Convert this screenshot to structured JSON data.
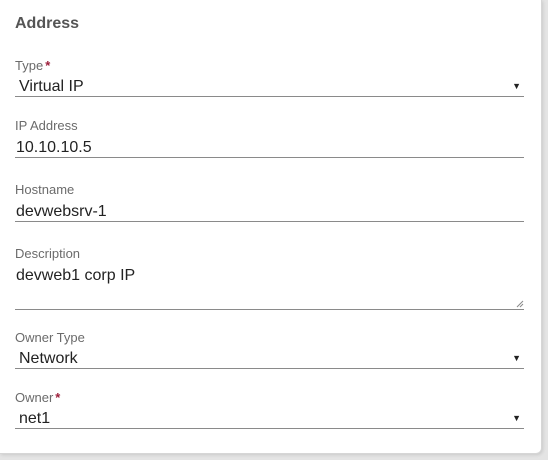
{
  "card": {
    "title": "Address"
  },
  "fields": {
    "type": {
      "label": "Type",
      "required_mark": "*",
      "value": "Virtual IP",
      "arrow_icon": "caret-down-icon"
    },
    "ip_address": {
      "label": "IP Address",
      "value": "10.10.10.5"
    },
    "hostname": {
      "label": "Hostname",
      "value": "devwebsrv-1"
    },
    "description": {
      "label": "Description",
      "value": "devweb1 corp IP",
      "resize_icon": "resize-grip-icon"
    },
    "owner_type": {
      "label": "Owner Type",
      "value": "Network",
      "arrow_icon": "caret-down-icon"
    },
    "owner": {
      "label": "Owner",
      "required_mark": "*",
      "value": "net1",
      "arrow_icon": "caret-down-icon"
    }
  },
  "colors": {
    "required": "#9c1e3a",
    "label": "#6b6b6b",
    "title": "#555555",
    "underline": "#8a8a8a"
  }
}
